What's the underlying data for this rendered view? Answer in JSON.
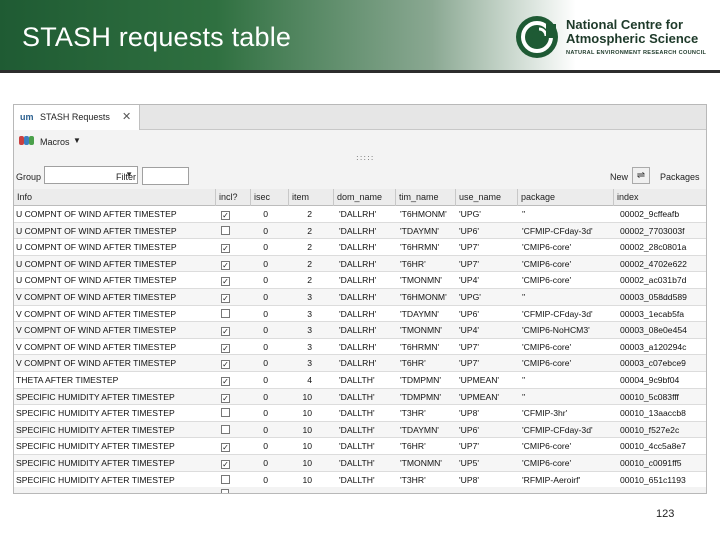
{
  "slide": {
    "title": "STASH requests table",
    "page_number": "123",
    "logo": {
      "line1": "National Centre for",
      "line2": "Atmospheric Science",
      "line3": "NATURAL ENVIRONMENT RESEARCH COUNCIL"
    }
  },
  "app": {
    "tab": {
      "icon": "um",
      "label": "STASH Requests",
      "close": "✕"
    },
    "toolbar": {
      "macros_label": "Macros",
      "macros_arrow": "▼"
    },
    "grip": ":::::",
    "filters": {
      "group_label": "Group",
      "group_value": "",
      "filter_label": "Filter",
      "filter_value": "",
      "new_label": "New",
      "new_icon": "⇌",
      "packages_label": "Packages"
    },
    "table": {
      "columns": [
        "Info",
        "incl?",
        "isec",
        "item",
        "dom_name",
        "tim_name",
        "use_name",
        "package",
        "index"
      ],
      "rows": [
        {
          "info": "U COMPNT OF WIND AFTER TIMESTEP",
          "incl": true,
          "sec": "0",
          "item": "2",
          "dom": "'DALLRH'",
          "tim": "'T6HMONM'",
          "use": "'UPG'",
          "pkg": "''",
          "idx": "00002_9cffeafb"
        },
        {
          "info": "U COMPNT OF WIND AFTER TIMESTEP",
          "incl": false,
          "sec": "0",
          "item": "2",
          "dom": "'DALLRH'",
          "tim": "'TDAYMN'",
          "use": "'UP6'",
          "pkg": "'CFMIP-CFday-3d'",
          "idx": "00002_7703003f"
        },
        {
          "info": "U COMPNT OF WIND AFTER TIMESTEP",
          "incl": true,
          "sec": "0",
          "item": "2",
          "dom": "'DALLRH'",
          "tim": "'T6HRMN'",
          "use": "'UP7'",
          "pkg": "'CMIP6-core'",
          "idx": "00002_28c0801a"
        },
        {
          "info": "U COMPNT OF WIND AFTER TIMESTEP",
          "incl": true,
          "sec": "0",
          "item": "2",
          "dom": "'DALLRH'",
          "tim": "'T6HR'",
          "use": "'UP7'",
          "pkg": "'CMIP6-core'",
          "idx": "00002_4702e622"
        },
        {
          "info": "U COMPNT OF WIND AFTER TIMESTEP",
          "incl": true,
          "sec": "0",
          "item": "2",
          "dom": "'DALLRH'",
          "tim": "'TMONMN'",
          "use": "'UP4'",
          "pkg": "'CMIP6-core'",
          "idx": "00002_ac031b7d"
        },
        {
          "info": "V COMPNT OF WIND AFTER TIMESTEP",
          "incl": true,
          "sec": "0",
          "item": "3",
          "dom": "'DALLRH'",
          "tim": "'T6HMONM'",
          "use": "'UPG'",
          "pkg": "''",
          "idx": "00003_058dd589"
        },
        {
          "info": "V COMPNT OF WIND AFTER TIMESTEP",
          "incl": false,
          "sec": "0",
          "item": "3",
          "dom": "'DALLRH'",
          "tim": "'TDAYMN'",
          "use": "'UP6'",
          "pkg": "'CFMIP-CFday-3d'",
          "idx": "00003_1ecab5fa"
        },
        {
          "info": "V COMPNT OF WIND AFTER TIMESTEP",
          "incl": true,
          "sec": "0",
          "item": "3",
          "dom": "'DALLRH'",
          "tim": "'TMONMN'",
          "use": "'UP4'",
          "pkg": "'CMIP6-NoHCM3'",
          "idx": "00003_08e0e454"
        },
        {
          "info": "V COMPNT OF WIND AFTER TIMESTEP",
          "incl": true,
          "sec": "0",
          "item": "3",
          "dom": "'DALLRH'",
          "tim": "'T6HRMN'",
          "use": "'UP7'",
          "pkg": "'CMIP6-core'",
          "idx": "00003_a120294c"
        },
        {
          "info": "V COMPNT OF WIND AFTER TIMESTEP",
          "incl": true,
          "sec": "0",
          "item": "3",
          "dom": "'DALLRH'",
          "tim": "'T6HR'",
          "use": "'UP7'",
          "pkg": "'CMIP6-core'",
          "idx": "00003_c07ebce9"
        },
        {
          "info": "THETA AFTER TIMESTEP",
          "incl": true,
          "sec": "0",
          "item": "4",
          "dom": "'DALLTH'",
          "tim": "'TDMPMN'",
          "use": "'UPMEAN'",
          "pkg": "''",
          "idx": "00004_9c9bf04"
        },
        {
          "info": "SPECIFIC HUMIDITY AFTER TIMESTEP",
          "incl": true,
          "sec": "0",
          "item": "10",
          "dom": "'DALLTH'",
          "tim": "'TDMPMN'",
          "use": "'UPMEAN'",
          "pkg": "''",
          "idx": "00010_5c083fff"
        },
        {
          "info": "SPECIFIC HUMIDITY AFTER TIMESTEP",
          "incl": false,
          "sec": "0",
          "item": "10",
          "dom": "'DALLTH'",
          "tim": "'T3HR'",
          "use": "'UP8'",
          "pkg": "'CFMIP-3hr'",
          "idx": "00010_13aaccb8"
        },
        {
          "info": "SPECIFIC HUMIDITY AFTER TIMESTEP",
          "incl": false,
          "sec": "0",
          "item": "10",
          "dom": "'DALLTH'",
          "tim": "'TDAYMN'",
          "use": "'UP6'",
          "pkg": "'CFMIP-CFday-3d'",
          "idx": "00010_f527e2c"
        },
        {
          "info": "SPECIFIC HUMIDITY AFTER TIMESTEP",
          "incl": true,
          "sec": "0",
          "item": "10",
          "dom": "'DALLTH'",
          "tim": "'T6HR'",
          "use": "'UP7'",
          "pkg": "'CMIP6-core'",
          "idx": "00010_4cc5a8e7"
        },
        {
          "info": "SPECIFIC HUMIDITY AFTER TIMESTEP",
          "incl": true,
          "sec": "0",
          "item": "10",
          "dom": "'DALLTH'",
          "tim": "'TMONMN'",
          "use": "'UP5'",
          "pkg": "'CMIP6-core'",
          "idx": "00010_c0091ff5"
        },
        {
          "info": "SPECIFIC HUMIDITY AFTER TIMESTEP",
          "incl": false,
          "sec": "0",
          "item": "10",
          "dom": "'DALLTH'",
          "tim": "'T3HR'",
          "use": "'UP8'",
          "pkg": "'RFMIP-Aeroirf'",
          "idx": "00010_651c1193"
        }
      ]
    }
  },
  "colors": {
    "header_dark": "#1f5b33",
    "logo_green": "#1e3a2a"
  }
}
